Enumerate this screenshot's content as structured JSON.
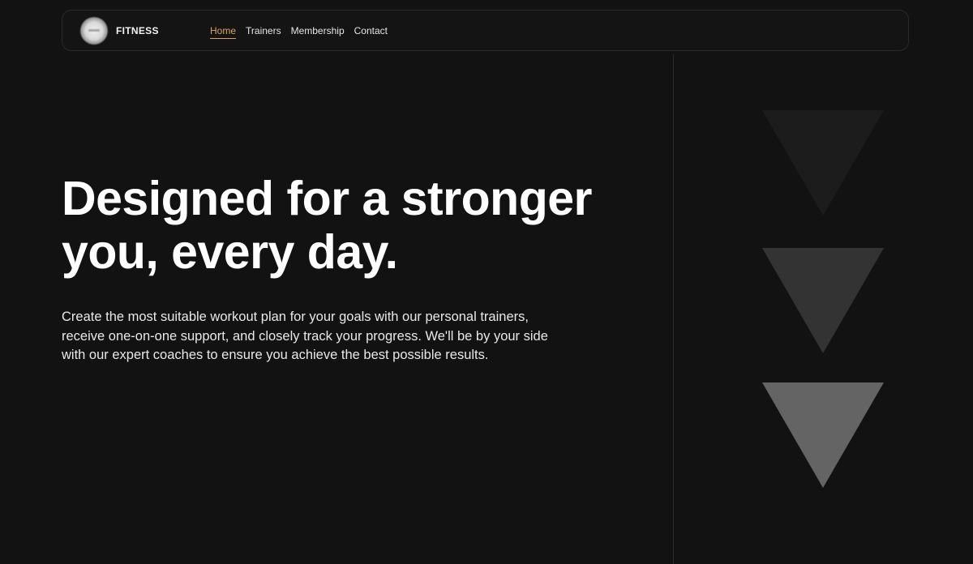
{
  "navbar": {
    "brand": "FITNESS",
    "links": [
      {
        "label": "Home",
        "active": true
      },
      {
        "label": "Trainers",
        "active": false
      },
      {
        "label": "Membership",
        "active": false
      },
      {
        "label": "Contact",
        "active": false
      }
    ]
  },
  "hero": {
    "title_line1": "Designed for a stronger",
    "title_line2": "you, every day.",
    "description": "Create the most suitable workout plan for your goals with our personal trainers, receive one-on-one support, and closely track your progress. We'll be by your side with our expert coaches to ensure you achieve the best possible results."
  },
  "decor": {
    "triangles": [
      {
        "icon": "triangle-down-icon",
        "color": "#1c1c1c"
      },
      {
        "icon": "triangle-down-icon",
        "color": "#333333"
      },
      {
        "icon": "triangle-down-icon",
        "color": "#646464"
      }
    ]
  },
  "colors": {
    "background": "#121212",
    "accent": "#d9a35a",
    "text": "#ffffff"
  }
}
